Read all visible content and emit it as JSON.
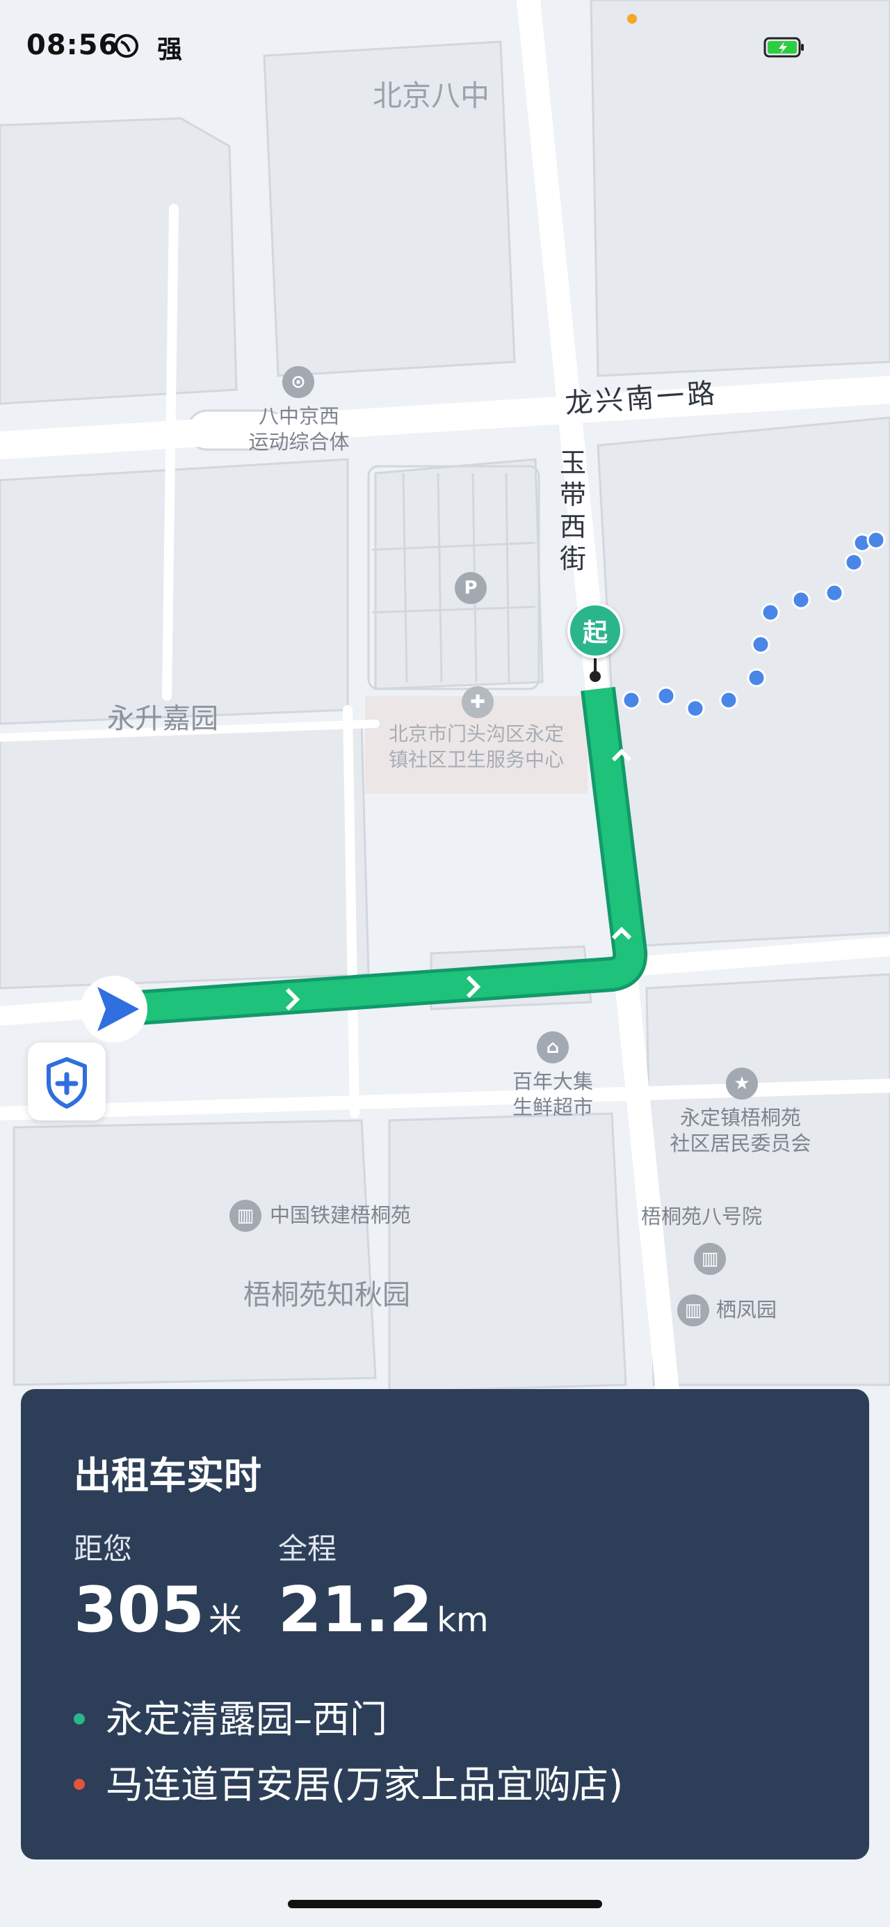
{
  "status_bar": {
    "time": "08:56",
    "signal_text": "强"
  },
  "map": {
    "labels": {
      "school": "北京八中",
      "road_east_west": "龙兴南一路",
      "road_north_south": [
        "玉",
        "带",
        "西",
        "街"
      ],
      "sports": [
        "八中京西",
        "运动综合体"
      ],
      "yongsheng": "永升嘉园",
      "health_center": [
        "北京市门头沟区永定",
        "镇社区卫生服务中心"
      ],
      "supermarket": [
        "百年大集",
        "生鲜超市"
      ],
      "committee": [
        "永定镇梧桐苑",
        "社区居民委员会"
      ],
      "crcc": "中国铁建梧桐苑",
      "wutong8": "梧桐苑八号院",
      "zhiqiu": "梧桐苑知秋园",
      "qifeng": "栖凤园"
    },
    "start_pin_label": "起",
    "route_color": "#1ec27a",
    "taxi_track_color": "#4a86e8"
  },
  "panel": {
    "title": "出租车实时",
    "distance_label": "距您",
    "distance_value": "305",
    "distance_unit": "米",
    "total_label": "全程",
    "total_value": "21.2",
    "total_unit": "km",
    "origin": "永定清露园–西门",
    "destination": "马连道百安居(万家上品宜购店)",
    "origin_color": "#2bb58b",
    "destination_color": "#e5533d"
  }
}
